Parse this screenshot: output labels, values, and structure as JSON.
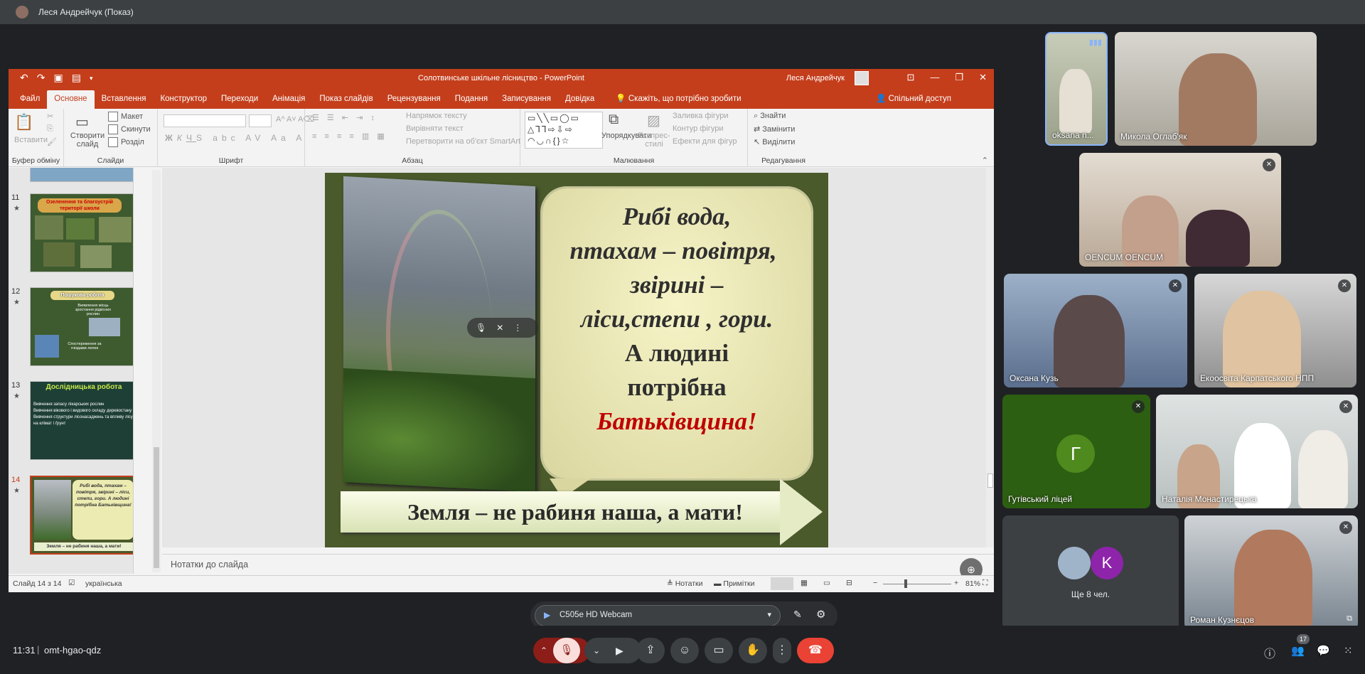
{
  "presenter": {
    "name": "Леся Андрейчук (Показ)"
  },
  "ppt": {
    "title": "Солотвинське шкільне лісництво  -  PowerPoint",
    "user": "Леся Андрейчук",
    "tabs": [
      "Файл",
      "Основне",
      "Вставлення",
      "Конструктор",
      "Переходи",
      "Анімація",
      "Показ слайдів",
      "Рецензування",
      "Подання",
      "Записування",
      "Довідка"
    ],
    "tellme": "Скажіть, що потрібно зробити",
    "share": "Спільний доступ",
    "ribbon": {
      "clipboard": {
        "label": "Буфер обміну",
        "paste": "Вставити"
      },
      "slides": {
        "label": "Слайди",
        "new_slide": "Створити слайд",
        "layout": "Макет",
        "reset": "Скинути",
        "section": "Розділ"
      },
      "font": {
        "label": "Шрифт"
      },
      "paragraph": {
        "label": "Абзац",
        "text_direction": "Напрямок тексту",
        "align_text": "Вирівняти текст",
        "smartart": "Перетворити на об'єкт SmartArt"
      },
      "drawing": {
        "label": "Малювання",
        "arrange": "Упорядкувати",
        "quick_styles": "Експрес-стилі",
        "fill": "Заливка фігури",
        "outline": "Контур фігури",
        "effects": "Ефекти для фігур"
      },
      "editing": {
        "label": "Редагування",
        "find": "Знайти",
        "replace": "Замінити",
        "select": "Виділити"
      }
    },
    "thumbnails": [
      {
        "num": "11",
        "caption": "Озеленення та благоустрій території школи"
      },
      {
        "num": "12",
        "caption": "Пошукова робота",
        "sub1": "Виявлення місць зростання рідкісних рослин",
        "sub2": "Спостереження за гніздами лелек"
      },
      {
        "num": "13",
        "caption": "Дослідницька робота",
        "items": [
          "Вивчення запасу лікарських рослин",
          "Вивчення вікового і видового складу деревостану",
          "Вивчення структури лісонасаджень та впливу лісу на клімат і ґрунт"
        ]
      },
      {
        "num": "14",
        "caption": "Рибі вода, птахам – повітря, звірині – ліси, степи, гори. А людині потрібна Батьківщина!",
        "footer": "Земля – не рабиня наша, а мати!"
      }
    ],
    "slide": {
      "line1": "Рибі вода,",
      "line2": "птахам – повітря,",
      "line3": "звірині –",
      "line4": "ліси,степи , гори.",
      "line5": "А людині",
      "line6": "потрібна",
      "line7": "Батьківщина!",
      "banner": "Земля – не рабиня наша, а мати!"
    },
    "notes_placeholder": "Нотатки до слайда",
    "status": {
      "slide": "Слайд 14 з 14",
      "language": "українська",
      "notes": "Нотатки",
      "comments": "Примітки",
      "zoom": "81%"
    }
  },
  "participants": [
    {
      "name": "oksana n...",
      "muted": false
    },
    {
      "name": "Микола Оглаб'як",
      "muted": false
    },
    {
      "name": "OENCUM OENCUM",
      "muted": true
    },
    {
      "name": "Оксана Кузь",
      "muted": true
    },
    {
      "name": "Екоосвіта Карпатського НПП",
      "muted": true
    },
    {
      "name": "Гутівський ліцей",
      "muted": true,
      "initial": "Г"
    },
    {
      "name": "Наталія Монастирецька",
      "muted": true
    },
    {
      "name": "Ще 8 чел.",
      "muted": false,
      "initial": "K"
    },
    {
      "name": "Роман Кузнєцов",
      "muted": true
    }
  ],
  "meeting": {
    "time": "11:31",
    "separator": "|",
    "code": "omt-hgao-qdz",
    "camera": "C505e HD Webcam",
    "people_count": "17"
  }
}
